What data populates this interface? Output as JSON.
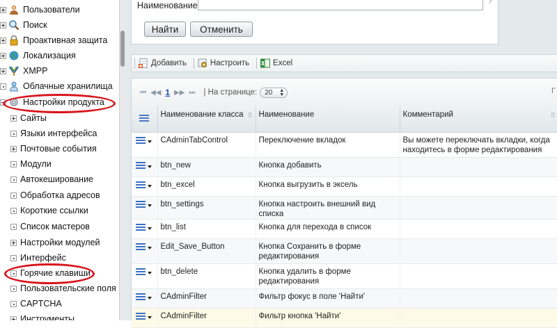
{
  "tree": {
    "items": [
      {
        "label": "Пользователи",
        "expander": "plus",
        "icon": "users-icon"
      },
      {
        "label": "Поиск",
        "expander": "plus",
        "icon": "search-icon"
      },
      {
        "label": "Проактивная защита",
        "expander": "plus",
        "icon": "lock-icon"
      },
      {
        "label": "Локализация",
        "expander": "plus",
        "icon": "globe-icon"
      },
      {
        "label": "XMPP",
        "expander": "plus",
        "icon": "xmpp-icon"
      },
      {
        "label": "Облачные хранилища",
        "expander": "dot",
        "icon": "cloud-user-icon"
      },
      {
        "label": "Настройки продукта",
        "expander": "minus",
        "icon": "settings-icon"
      }
    ],
    "children": [
      {
        "label": "Сайты",
        "expander": "plus"
      },
      {
        "label": "Языки интерфейса",
        "expander": "dot"
      },
      {
        "label": "Почтовые события",
        "expander": "plus"
      },
      {
        "label": "Модули",
        "expander": "dot"
      },
      {
        "label": "Автокеширование",
        "expander": "dot"
      },
      {
        "label": "Обработка адресов",
        "expander": "dot"
      },
      {
        "label": "Короткие ссылки",
        "expander": "dot"
      },
      {
        "label": "Список мастеров",
        "expander": "dot"
      },
      {
        "label": "Настройки модулей",
        "expander": "plus"
      },
      {
        "label": "Интерфейс",
        "expander": "dot"
      },
      {
        "label": "Горячие клавиши",
        "expander": "dot"
      },
      {
        "label": "Пользовательские поля",
        "expander": "dot"
      },
      {
        "label": "CAPTCHA",
        "expander": "dot"
      },
      {
        "label": "Инструменты",
        "expander": "plus"
      }
    ]
  },
  "filter": {
    "name_label": "Наименование:",
    "name_value": "",
    "help": "?",
    "find_label": "Найти",
    "cancel_label": "Отменить"
  },
  "toolbar": {
    "add_label": "Добавить",
    "settings_label": "Настроить",
    "excel_label": "Excel"
  },
  "pager": {
    "first": "⏮",
    "prev": "◀◀",
    "current": "1",
    "next": "▶▶",
    "last": "⏭",
    "per_page_label": "| На странице:",
    "per_page_value": "20",
    "right_mark": "Г"
  },
  "grid": {
    "columns": [
      "Наименование класса",
      "Наименование",
      "Комментарий"
    ],
    "rows": [
      {
        "class": "CAdminTabControl",
        "name": "Переключение вкладок",
        "comment": "Вы можете переключать вкладки, когда находитесь в форме редактирования"
      },
      {
        "class": "btn_new",
        "name": "Кнопка добавить",
        "comment": ""
      },
      {
        "class": "btn_excel",
        "name": "Кнопка выгрузить в эксель",
        "comment": ""
      },
      {
        "class": "btn_settings",
        "name": "Кнопка настроить внешний вид списка",
        "comment": ""
      },
      {
        "class": "btn_list",
        "name": "Кнопка для перехода в список",
        "comment": ""
      },
      {
        "class": "Edit_Save_Button",
        "name": "Кнопка Сохранить в форме редактирования",
        "comment": ""
      },
      {
        "class": "btn_delete",
        "name": "Кнопка удалить в форме редактирования",
        "comment": ""
      },
      {
        "class": "CAdminFilter",
        "name": "Фильтр фокус в поле 'Найти'",
        "comment": ""
      },
      {
        "class": "CAdminFilter",
        "name": "Фильтр кнопка 'Найти'",
        "comment": ""
      }
    ]
  },
  "colors": {
    "highlight_ellipse": "#d8141c",
    "menu_icon": "#3a6fc4",
    "panel_bg": "#e4e9ec"
  }
}
